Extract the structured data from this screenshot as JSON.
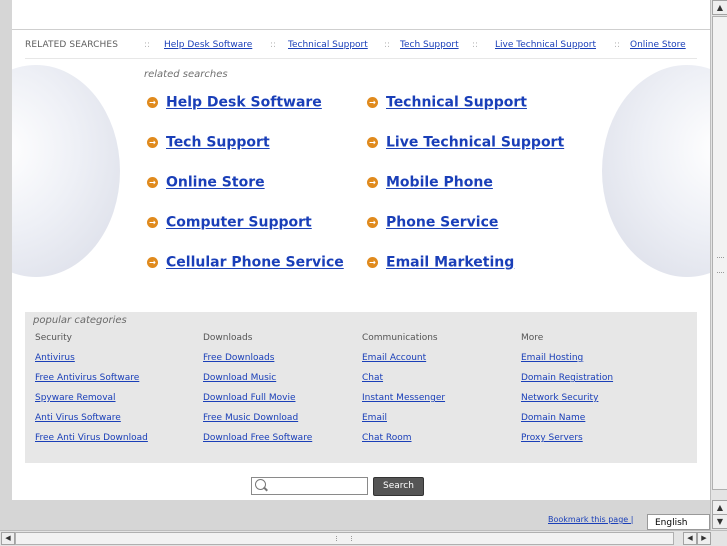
{
  "related_bar": {
    "label": "RELATED SEARCHES",
    "separator": "::",
    "links": [
      "Help Desk Software",
      "Technical Support",
      "Tech Support",
      "Live Technical Support",
      "Online Store"
    ]
  },
  "related_searches": {
    "heading": "related searches",
    "items": [
      "Help Desk Software",
      "Technical Support",
      "Tech Support",
      "Live Technical Support",
      "Online Store",
      "Mobile Phone",
      "Computer Support",
      "Phone Service",
      "Cellular Phone Service",
      "Email Marketing"
    ]
  },
  "popular": {
    "heading": "popular categories",
    "columns": [
      {
        "title": "Security",
        "links": [
          "Antivirus",
          "Free Antivirus Software",
          "Spyware Removal",
          "Anti Virus Software",
          "Free Anti Virus Download"
        ]
      },
      {
        "title": "Downloads",
        "links": [
          "Free Downloads",
          "Download Music",
          "Download Full Movie",
          "Free Music Download",
          "Download Free Software"
        ]
      },
      {
        "title": "Communications",
        "links": [
          "Email Account",
          "Chat",
          "Instant Messenger",
          "Email",
          "Chat Room"
        ]
      },
      {
        "title": "More",
        "links": [
          "Email Hosting",
          "Domain Registration",
          "Network Security",
          "Domain Name",
          "Proxy Servers"
        ]
      }
    ]
  },
  "search": {
    "value": "",
    "button_label": "Search"
  },
  "footer": {
    "bookmark_label": "Bookmark this page |",
    "language": "English"
  },
  "colors": {
    "link": "#1a3fb8",
    "arrow": "#e08a1d",
    "panel": "#e7e7e7"
  }
}
